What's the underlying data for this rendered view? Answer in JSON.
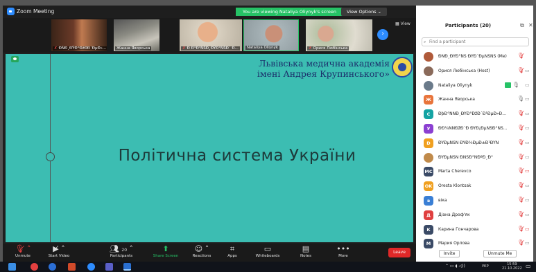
{
  "window": {
    "title": "Zoom Meeting",
    "viewing_banner": "You are viewing Nataliya Oliynyk's screen",
    "view_options": "View Options",
    "minimize": "—",
    "restore": "❐",
    "close": "✕"
  },
  "strip": {
    "view_label": "View",
    "tiles": [
      {
        "name": "ÐŃÐ¸ÐŸÐ°ÐžÐ­Ð´ÐµÐ»..."
      },
      {
        "name": "Жанна Яворська"
      },
      {
        "name": "Ð Ð°Ð¹ÑŠÐ¸ÐŸÐ°ÑŠÐ´ Ð..."
      },
      {
        "name": "Nataliya Oliynyk"
      },
      {
        "name": "Орися Любінська"
      }
    ]
  },
  "slide": {
    "academy_line1": "Львівська медична академія",
    "academy_line2": "імені Андрея Крупинського»",
    "title": "Політична система України"
  },
  "toolbar": {
    "unmute": "Unmute",
    "start_video": "Start Video",
    "participants": "Participants",
    "participants_count": "20",
    "share_screen": "Share Screen",
    "reactions": "Reactions",
    "apps": "Apps",
    "whiteboards": "Whiteboards",
    "notes": "Notes",
    "more": "More",
    "leave": "Leave"
  },
  "panel": {
    "title": "Participants (20)",
    "search_placeholder": "Find a participant",
    "invite": "Invite",
    "unmute_me": "Unmute Me",
    "participants": [
      {
        "name": "ÐŃÐ¸ÐŸÐ°ÑŠ ÐŸÐ´ÐµÑŠÑŠ (Me)",
        "initial": "",
        "color": "#b05a3a",
        "mic": "muted",
        "cam": ""
      },
      {
        "name": "Орися Любінська (Host)",
        "initial": "",
        "color": "#8a6a5a",
        "mic": "muted",
        "cam": "off"
      },
      {
        "name": "Nataliya Oliynyk",
        "initial": "",
        "color": "#6a7a8a",
        "mic": "on",
        "cam": "off"
      },
      {
        "name": "Жанна Яворська",
        "initial": "Ж",
        "color": "#e8743b",
        "mic": "on",
        "cam": "off"
      },
      {
        "name": "ÐþÐ°ÑÑÐ¸ÐŸÐ°ÐžÐ´Ð¹ÐµÐ»Ð...",
        "initial": "С",
        "color": "#14a3a3",
        "mic": "muted",
        "cam": "off"
      },
      {
        "name": "ÐÐ¾ÑÑÐžÐ´Ð ÐŸÐ¡ÐµÑŠÐ°ÑŠ...",
        "initial": "У",
        "color": "#8b3fd1",
        "mic": "muted",
        "cam": "off"
      },
      {
        "name": "ÐŸÐµÑŠÑ ÐŸÐ¾ÐµÐ±Ð¹ÐŸÑ",
        "initial": "D",
        "color": "#f0a020",
        "mic": "muted",
        "cam": "off"
      },
      {
        "name": "ÐŸÐµÑŠÑ ÐÑŠÐ°ÑÐºÐ¸Ð°",
        "initial": "",
        "color": "#c08a4a",
        "mic": "muted",
        "cam": "off"
      },
      {
        "name": "Marta Cherevco",
        "initial": "MC",
        "color": "#3a4a66",
        "mic": "muted",
        "cam": "redoff"
      },
      {
        "name": "Oresta Klontsak",
        "initial": "OK",
        "color": "#f0a020",
        "mic": "muted",
        "cam": "off"
      },
      {
        "name": "віка",
        "initial": "в",
        "color": "#3a7fd5",
        "mic": "muted",
        "cam": "off"
      },
      {
        "name": "Діана Дроф'як",
        "initial": "Д",
        "color": "#e04040",
        "mic": "muted",
        "cam": "off"
      },
      {
        "name": "Карина Гончарова",
        "initial": "К",
        "color": "#3a4a66",
        "mic": "muted",
        "cam": "redoff"
      },
      {
        "name": "Мария Орлова",
        "initial": "М",
        "color": "#3a4a66",
        "mic": "muted",
        "cam": "off"
      }
    ]
  },
  "taskbar": {
    "lang": "УКР",
    "time": "15:59",
    "date": "21.10.2022"
  }
}
